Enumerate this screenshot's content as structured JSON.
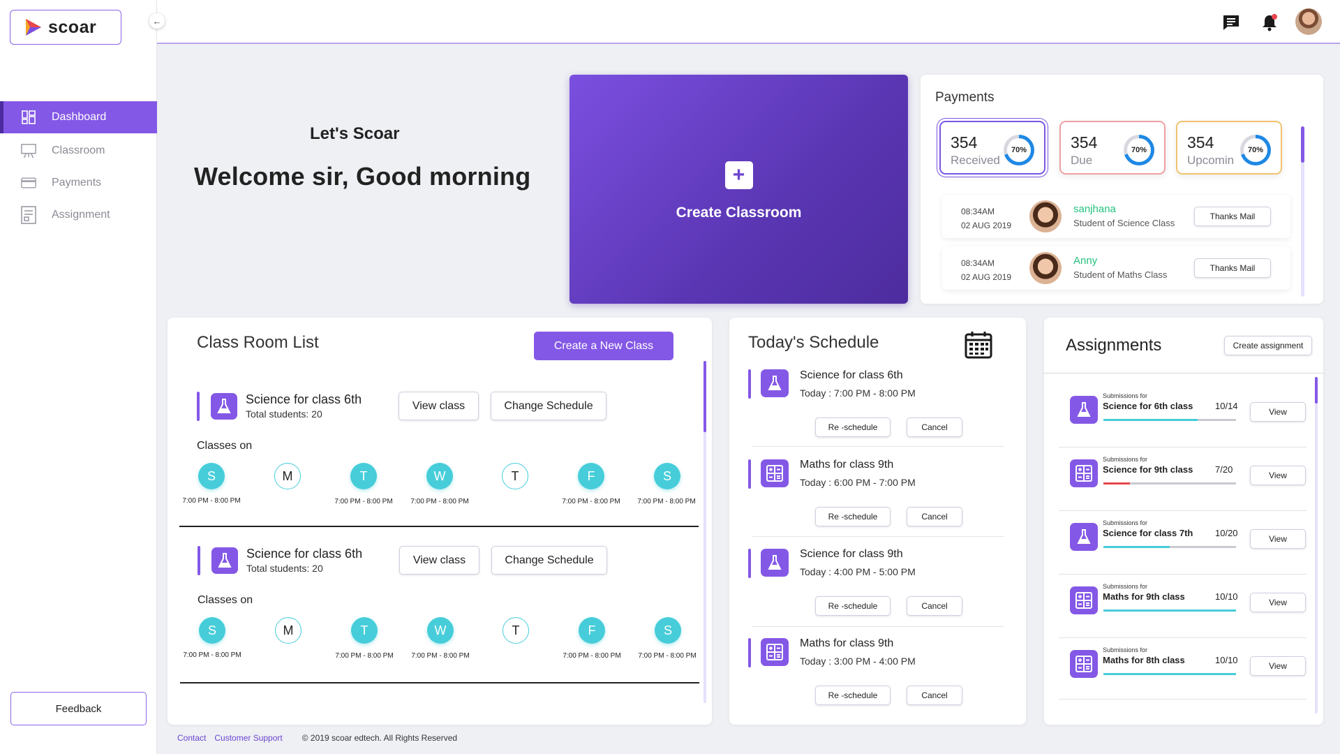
{
  "brand": {
    "name": "scoar"
  },
  "sidebar": {
    "items": [
      {
        "label": "Dashboard",
        "icon": "grid-icon",
        "active": true
      },
      {
        "label": "Classroom",
        "icon": "whiteboard-icon",
        "active": false
      },
      {
        "label": "Payments",
        "icon": "card-icon",
        "active": false
      },
      {
        "label": "Assignment",
        "icon": "document-icon",
        "active": false
      }
    ],
    "feedback_label": "Feedback"
  },
  "header": {
    "icons": [
      "chat-icon",
      "bell-icon",
      "avatar"
    ]
  },
  "welcome": {
    "greeting": "Let's Scoar",
    "message": "Welcome sir, Good morning"
  },
  "create_classroom": {
    "label": "Create Classroom"
  },
  "payments": {
    "title": "Payments",
    "cards": [
      {
        "value": "354",
        "label": "Received",
        "percent_text": "70%",
        "border": "#7b55e0"
      },
      {
        "value": "354",
        "label": "Due",
        "percent_text": "70%",
        "border": "#f0a0a0"
      },
      {
        "value": "354",
        "label": "Upcomin",
        "percent_text": "70%",
        "border": "#f2c270"
      }
    ],
    "transactions": [
      {
        "time": "08:34AM",
        "date": "02 AUG 2019",
        "name": "sanjhana",
        "subtitle": "Student of Science Class",
        "button": "Thanks Mail"
      },
      {
        "time": "08:34AM",
        "date": "02 AUG 2019",
        "name": "Anny",
        "subtitle": "Student of Maths Class",
        "button": "Thanks Mail"
      }
    ]
  },
  "classroom_list": {
    "title": "Class Room List",
    "new_class_label": "Create a New Class",
    "classes_on_label": "Classes on",
    "classes": [
      {
        "name": "Science for class 6th",
        "students": "Total students: 20",
        "view_label": "View class",
        "schedule_label": "Change Schedule",
        "days": [
          {
            "letter": "S",
            "on": true,
            "time": "7:00 PM - 8:00 PM"
          },
          {
            "letter": "M",
            "on": false,
            "time": ""
          },
          {
            "letter": "T",
            "on": true,
            "time": "7:00 PM - 8:00 PM"
          },
          {
            "letter": "W",
            "on": true,
            "time": "7:00 PM - 8:00 PM"
          },
          {
            "letter": "T",
            "on": false,
            "time": ""
          },
          {
            "letter": "F",
            "on": true,
            "time": "7:00 PM - 8:00 PM"
          },
          {
            "letter": "S",
            "on": true,
            "time": "7:00 PM - 8:00 PM"
          }
        ]
      },
      {
        "name": "Science for class 6th",
        "students": "Total students: 20",
        "view_label": "View class",
        "schedule_label": "Change Schedule",
        "days": [
          {
            "letter": "S",
            "on": true,
            "time": "7:00 PM - 8:00 PM"
          },
          {
            "letter": "M",
            "on": false,
            "time": ""
          },
          {
            "letter": "T",
            "on": true,
            "time": "7:00 PM - 8:00 PM"
          },
          {
            "letter": "W",
            "on": true,
            "time": "7:00 PM - 8:00 PM"
          },
          {
            "letter": "T",
            "on": false,
            "time": ""
          },
          {
            "letter": "F",
            "on": true,
            "time": "7:00 PM - 8:00 PM"
          },
          {
            "letter": "S",
            "on": true,
            "time": "7:00 PM - 8:00 PM"
          }
        ]
      }
    ]
  },
  "schedule": {
    "title": "Today's Schedule",
    "items": [
      {
        "name": "Science for class 6th",
        "time": "Today : 7:00 PM - 8:00 PM",
        "icon": "flask-icon",
        "reschedule": "Re -schedule",
        "cancel": "Cancel"
      },
      {
        "name": "Maths for class 9th",
        "time": "Today : 6:00 PM - 7:00 PM",
        "icon": "calculator-icon",
        "reschedule": "Re -schedule",
        "cancel": "Cancel"
      },
      {
        "name": "Science for class 9th",
        "time": "Today : 4:00 PM - 5:00 PM",
        "icon": "flask-icon",
        "reschedule": "Re -schedule",
        "cancel": "Cancel"
      },
      {
        "name": "Maths for class 9th",
        "time": "Today : 3:00 PM - 4:00 PM",
        "icon": "calculator-icon",
        "reschedule": "Re -schedule",
        "cancel": "Cancel"
      }
    ]
  },
  "assignments": {
    "title": "Assignments",
    "create_label": "Create assignment",
    "items": [
      {
        "prefix": "Submissions for",
        "name": "Science for 6th class",
        "count": "10/14",
        "progress": 0.71,
        "color": "#46cdd9",
        "icon": "flask-icon",
        "view": "View"
      },
      {
        "prefix": "Submissions for",
        "name": "Science for 9th class",
        "count": "7/20",
        "progress": 0.2,
        "color": "#e8454d",
        "icon": "calculator-icon",
        "view": "View"
      },
      {
        "prefix": "Submissions for",
        "name": "Science for class 7th",
        "count": "10/20",
        "progress": 0.5,
        "color": "#46cdd9",
        "icon": "flask-icon",
        "view": "View"
      },
      {
        "prefix": "Submissions for",
        "name": "Maths for 9th class",
        "count": "10/10",
        "progress": 1.0,
        "color": "#46cdd9",
        "icon": "calculator-icon",
        "view": "View"
      },
      {
        "prefix": "Submissions for",
        "name": "Maths for 8th class",
        "count": "10/10",
        "progress": 1.0,
        "color": "#46cdd9",
        "icon": "calculator-icon",
        "view": "View"
      }
    ]
  },
  "footer": {
    "contact": "Contact",
    "support": "Customer Support",
    "copyright": "© 2019 scoar edtech. All Rights Reserved"
  },
  "colors": {
    "accent": "#8458e6",
    "teal": "#46cdd9",
    "green": "#24c27e"
  }
}
